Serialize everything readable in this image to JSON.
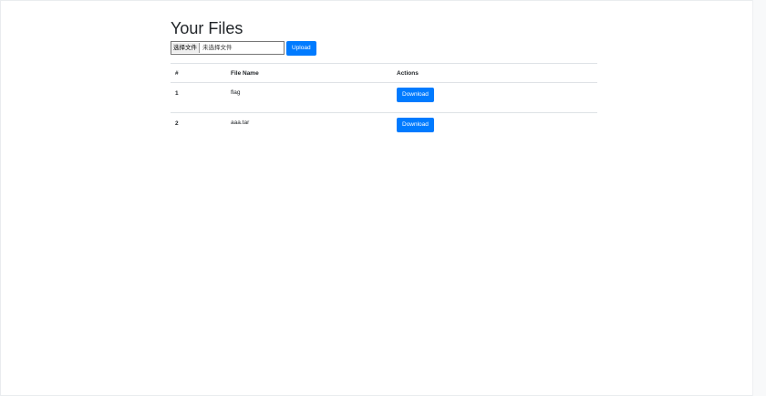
{
  "page": {
    "title": "Your Files"
  },
  "upload": {
    "choose_label": "选择文件",
    "status_text": "未选择文件",
    "button_label": "Upload"
  },
  "table": {
    "headers": [
      "#",
      "File Name",
      "Actions"
    ],
    "rows": [
      {
        "num": "1",
        "name": "flag",
        "action": "Download"
      },
      {
        "num": "2",
        "name": "aaa.tar",
        "action": "Download"
      }
    ]
  },
  "colors": {
    "primary": "#007bff",
    "text": "#212529",
    "border": "#dee2e6"
  }
}
